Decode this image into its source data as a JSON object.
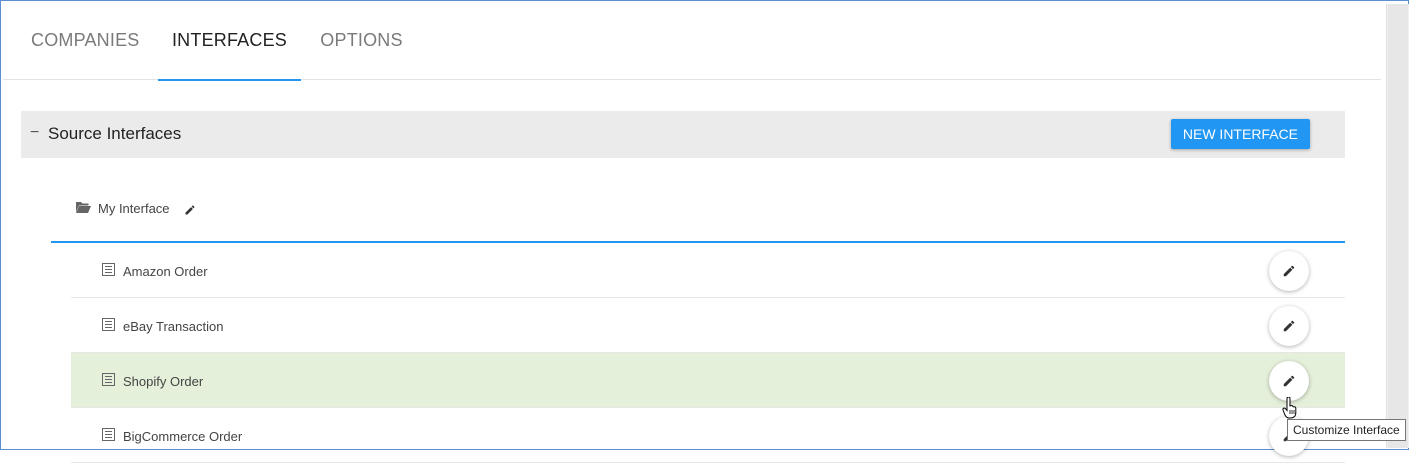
{
  "tabs": [
    {
      "label": "COMPANIES",
      "active": false
    },
    {
      "label": "INTERFACES",
      "active": true
    },
    {
      "label": "OPTIONS",
      "active": false
    }
  ],
  "section": {
    "collapse_symbol": "−",
    "title": "Source Interfaces",
    "new_button_label": "NEW INTERFACE"
  },
  "group": {
    "label": "My Interface",
    "icon": "folder-open-icon"
  },
  "items": [
    {
      "label": "Amazon Order",
      "selected": false
    },
    {
      "label": "eBay Transaction",
      "selected": false
    },
    {
      "label": "Shopify Order",
      "selected": true
    },
    {
      "label": "BigCommerce Order",
      "selected": false
    }
  ],
  "tooltip": {
    "text": "Customize Interface"
  },
  "colors": {
    "accent": "#2196f3",
    "selected_row": "#e5f0da",
    "section_header_bg": "#ebebeb"
  }
}
